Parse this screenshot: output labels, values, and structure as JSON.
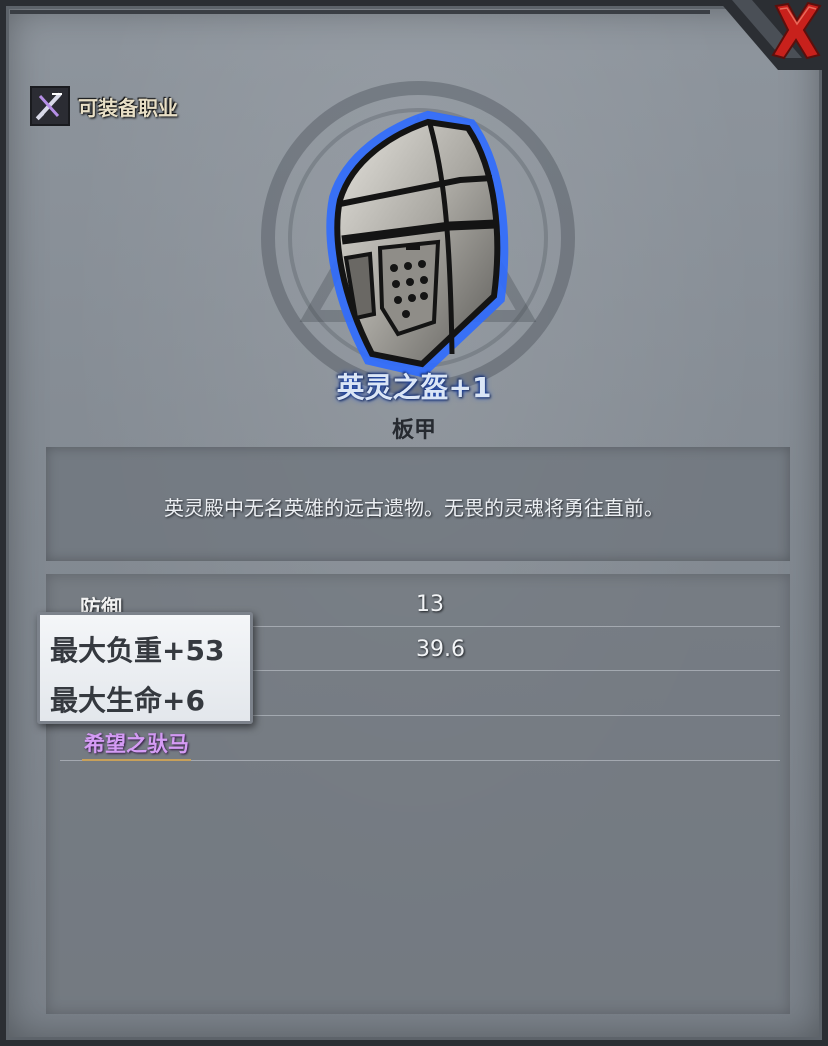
{
  "header": {
    "job_label": "可装备职业"
  },
  "item": {
    "name": "英灵之盔+1",
    "type": "板甲",
    "description": "英灵殿中无名英雄的远古遗物。无畏的灵魂将勇往直前。",
    "glow_color": "#2f6cff"
  },
  "stats": [
    {
      "label": "防御",
      "value": "13"
    },
    {
      "label": "",
      "value": "39.6"
    }
  ],
  "set_name": "希望之驮马",
  "tooltip": {
    "lines": [
      "最大负重+53",
      "最大生命+6"
    ]
  },
  "colors": {
    "close_red": "#c8211c",
    "set_purple": "#d59cf5"
  },
  "icons": {
    "close": "close-x-icon",
    "job": "crossed-weapons-icon",
    "helmet": "great-helm-icon"
  }
}
